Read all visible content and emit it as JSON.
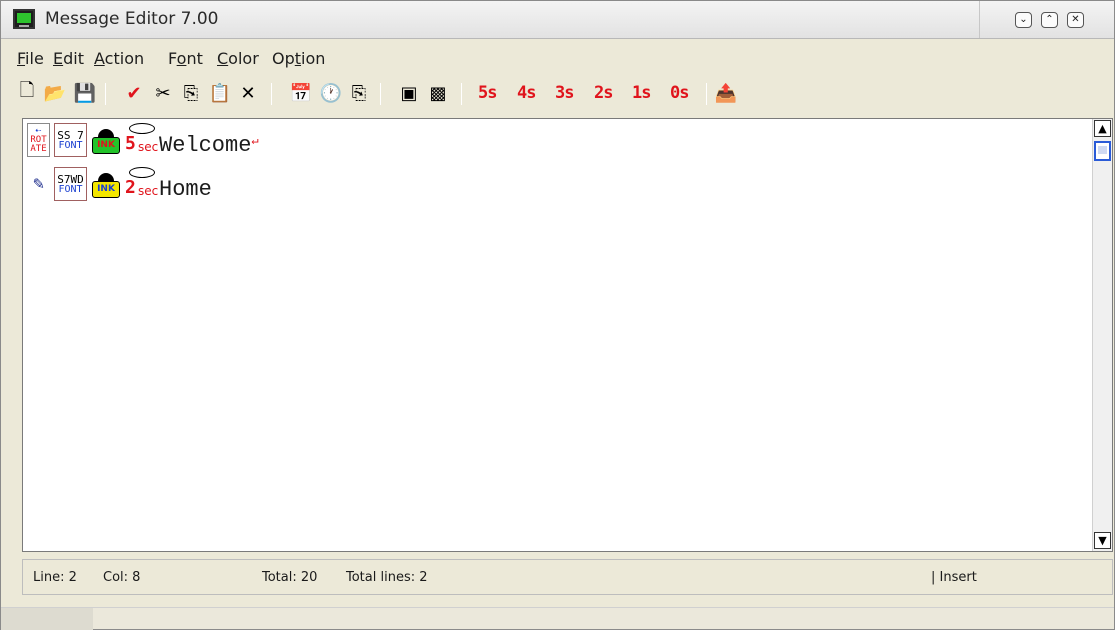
{
  "window": {
    "title": "Message Editor 7.00",
    "icon": "monitor-icon",
    "controls": {
      "minimize": "⌄",
      "restore": "⌃",
      "close": "✕"
    }
  },
  "menu": [
    {
      "pre": "",
      "ul": "F",
      "post": "ile"
    },
    {
      "pre": "",
      "ul": "E",
      "post": "dit"
    },
    {
      "pre": "",
      "ul": "A",
      "post": "ction"
    },
    {
      "pre": "F",
      "ul": "o",
      "post": "nt"
    },
    {
      "pre": "",
      "ul": "C",
      "post": "olor"
    },
    {
      "pre": "Op",
      "ul": "t",
      "post": "ion"
    }
  ],
  "toolbar": {
    "new": "🗋",
    "open": "📂",
    "save": "💾",
    "check": "✔",
    "cut": "✂",
    "copy": "⎘",
    "paste": "📋",
    "delete": "✕",
    "insert_date": "📅",
    "insert_time": "🕐",
    "duplicate": "⎘",
    "frame_a": "▣",
    "frame_b": "▩",
    "time_buttons": [
      "5s",
      "4s",
      "3s",
      "2s",
      "1s",
      "0s"
    ],
    "send": "📤"
  },
  "colors": {
    "accent_red": "#e0141c",
    "ink_green": "#22c32a",
    "ink_yellow": "#f3e600",
    "code_blue": "#1a3fd0"
  },
  "lines": [
    {
      "effect": {
        "top": "ROT",
        "bottom": "ATE"
      },
      "font": {
        "top": "SS 7",
        "bottom": "FONT"
      },
      "ink": "INK",
      "duration": {
        "num": "5",
        "unit": "sec"
      },
      "text": "Welcome"
    },
    {
      "effect": {
        "top": "",
        "bottom": ""
      },
      "font": {
        "top": "S7WD",
        "bottom": "FONT"
      },
      "ink": "INK",
      "duration": {
        "num": "2",
        "unit": "sec"
      },
      "text": "Home"
    }
  ],
  "status": {
    "line": "Line: 2",
    "col": "Col: 8",
    "total": "Total: 20",
    "total_lines": "Total lines: 2",
    "mode": "| Insert"
  }
}
